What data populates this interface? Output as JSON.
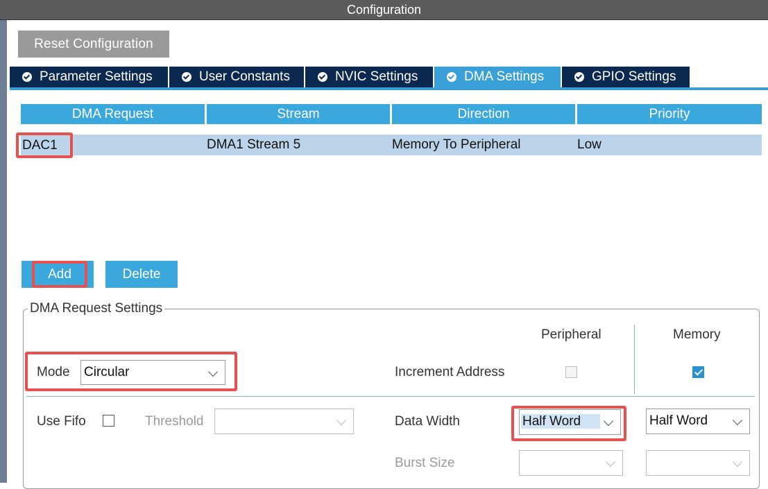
{
  "window": {
    "title": "Configuration"
  },
  "toolbar": {
    "reset_label": "Reset Configuration"
  },
  "tabs": [
    {
      "label": "Parameter Settings",
      "active": false
    },
    {
      "label": "User Constants",
      "active": false
    },
    {
      "label": "NVIC Settings",
      "active": false
    },
    {
      "label": "DMA Settings",
      "active": true
    },
    {
      "label": "GPIO Settings",
      "active": false
    }
  ],
  "table": {
    "headers": [
      "DMA Request",
      "Stream",
      "Direction",
      "Priority"
    ],
    "rows": [
      {
        "request": "DAC1",
        "stream": "DMA1 Stream 5",
        "direction": "Memory To Peripheral",
        "priority": "Low"
      }
    ]
  },
  "actions": {
    "add_label": "Add",
    "delete_label": "Delete"
  },
  "settings": {
    "legend": "DMA Request Settings",
    "mode_label": "Mode",
    "mode_value": "Circular",
    "peripheral_header": "Peripheral",
    "memory_header": "Memory",
    "increment_label": "Increment Address",
    "increment_peripheral": false,
    "increment_memory": true,
    "use_fifo_label": "Use Fifo",
    "use_fifo": false,
    "threshold_label": "Threshold",
    "threshold_value": "",
    "data_width_label": "Data Width",
    "data_width_peripheral": "Half Word",
    "data_width_memory": "Half Word",
    "burst_size_label": "Burst Size",
    "burst_peripheral": "",
    "burst_memory": ""
  },
  "colors": {
    "accent": "#3aa8dc",
    "tab_dark": "#0b2850",
    "highlight": "#e8504f",
    "row_selected": "#bcd4ea"
  }
}
